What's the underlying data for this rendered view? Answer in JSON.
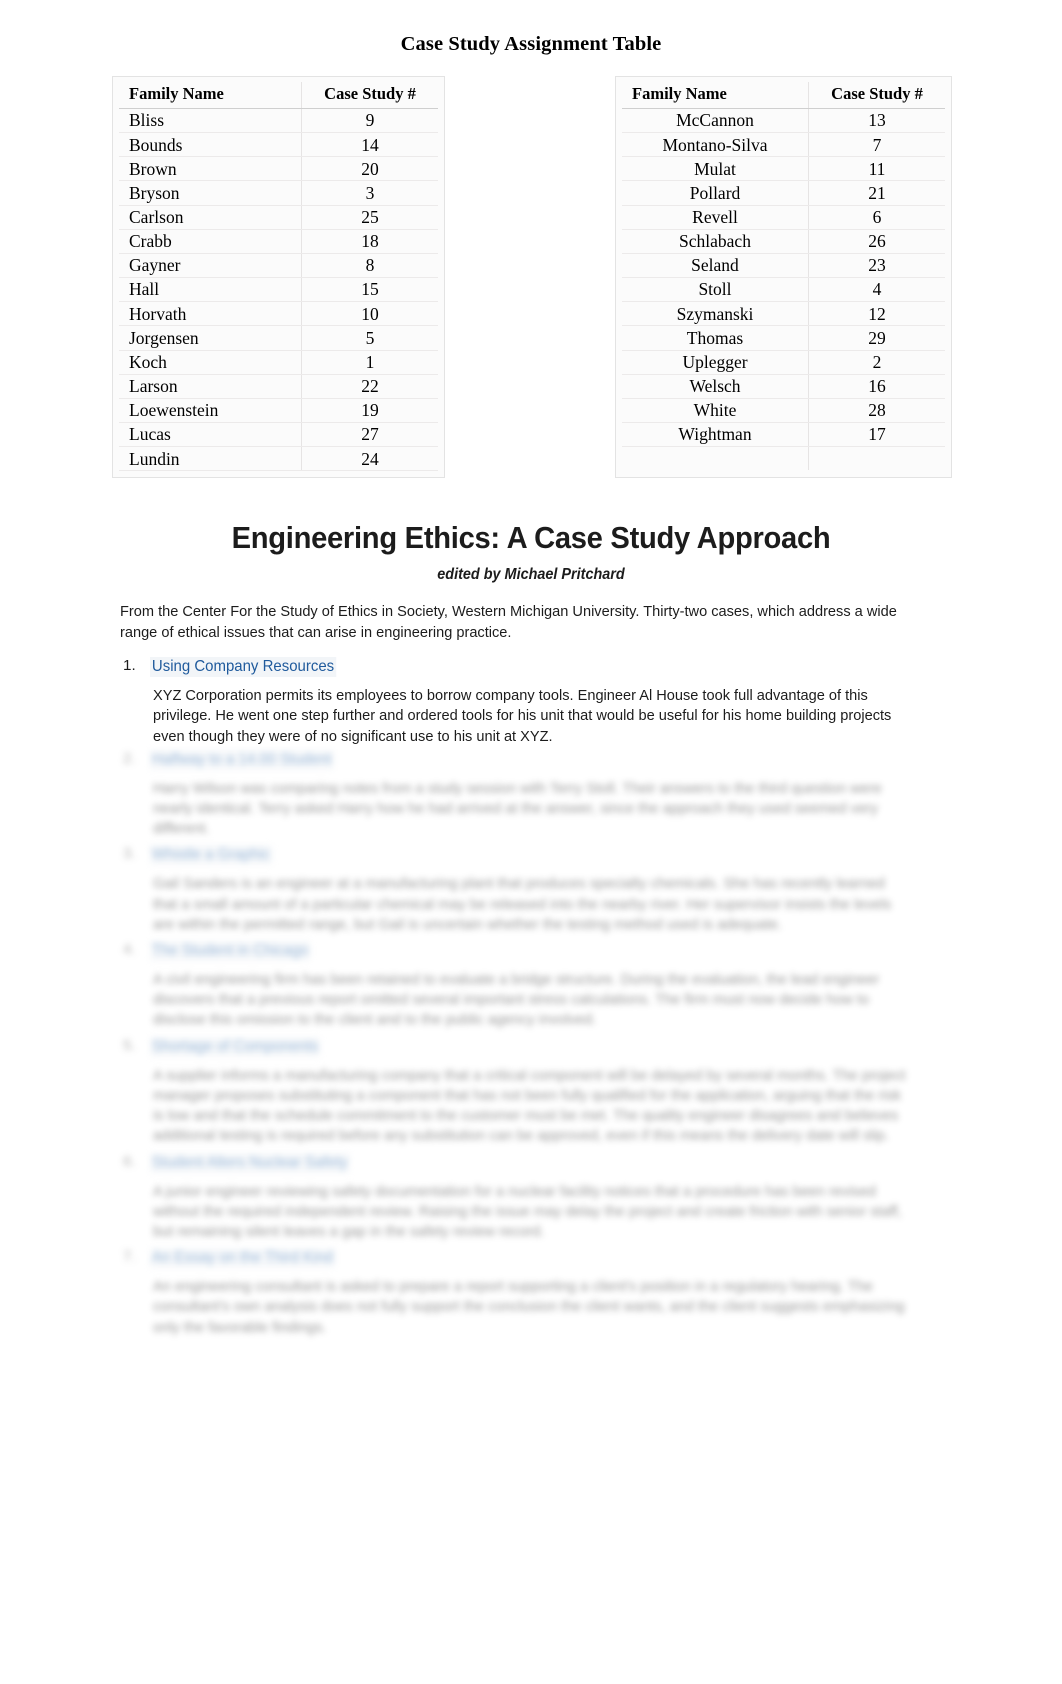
{
  "document": {
    "table_title": "Case Study Assignment Table",
    "tables": {
      "headers": [
        "Family Name",
        "Case Study #"
      ],
      "left": [
        {
          "name": "Bliss",
          "case": "9"
        },
        {
          "name": "Bounds",
          "case": "14"
        },
        {
          "name": "Brown",
          "case": "20"
        },
        {
          "name": "Bryson",
          "case": "3"
        },
        {
          "name": "Carlson",
          "case": "25"
        },
        {
          "name": "Crabb",
          "case": "18"
        },
        {
          "name": "Gayner",
          "case": "8"
        },
        {
          "name": "Hall",
          "case": "15"
        },
        {
          "name": "Horvath",
          "case": "10"
        },
        {
          "name": "Jorgensen",
          "case": "5"
        },
        {
          "name": "Koch",
          "case": "1"
        },
        {
          "name": "Larson",
          "case": "22"
        },
        {
          "name": "Loewenstein",
          "case": "19"
        },
        {
          "name": "Lucas",
          "case": "27"
        },
        {
          "name": "Lundin",
          "case": "24"
        }
      ],
      "right": [
        {
          "name": "McCannon",
          "case": "13"
        },
        {
          "name": "Montano-Silva",
          "case": "7"
        },
        {
          "name": "Mulat",
          "case": "11"
        },
        {
          "name": "Pollard",
          "case": "21"
        },
        {
          "name": "Revell",
          "case": "6"
        },
        {
          "name": "Schlabach",
          "case": "26"
        },
        {
          "name": "Seland",
          "case": "23"
        },
        {
          "name": "Stoll",
          "case": "4"
        },
        {
          "name": "Szymanski",
          "case": "12"
        },
        {
          "name": "Thomas",
          "case": "29"
        },
        {
          "name": "Uplegger",
          "case": "2"
        },
        {
          "name": "Welsch",
          "case": "16"
        },
        {
          "name": "White",
          "case": "28"
        },
        {
          "name": "Wightman",
          "case": "17"
        }
      ]
    },
    "book": {
      "title": "Engineering Ethics: A Case Study Approach",
      "editor": "edited by Michael Pritchard",
      "blurb": "From the Center For the Study of Ethics in Society, Western Michigan University. Thirty-two cases, which address a wide range of ethical issues that can arise in engineering practice."
    },
    "cases": [
      {
        "number": "1.",
        "link": "Using Company Resources",
        "body": "XYZ Corporation permits its employees to borrow company tools. Engineer Al House took full advantage of this privilege. He went one step further and ordered tools for his unit that would be useful for his home building projects even though they were of no significant use to his unit at XYZ.",
        "blurred": false
      },
      {
        "number": "2.",
        "link": "Halfway to a 14.00 Student",
        "body": "Harry Wilson was comparing notes from a study session with Terry Stoll. Their answers to the third question were nearly identical. Terry asked Harry how he had arrived at the answer, since the approach they used seemed very different.",
        "blurred": true
      },
      {
        "number": "3.",
        "link": "Whistle a Graphic",
        "body": "Gail Sanders is an engineer at a manufacturing plant that produces specialty chemicals. She has recently learned that a small amount of a particular chemical may be released into the nearby river. Her supervisor insists the levels are within the permitted range, but Gail is uncertain whether the testing method used is adequate.",
        "blurred": true
      },
      {
        "number": "4.",
        "link": "The Student in Chicago",
        "body": "A civil engineering firm has been retained to evaluate a bridge structure. During the evaluation, the lead engineer discovers that a previous report omitted several important stress calculations. The firm must now decide how to disclose this omission to the client and to the public agency involved.",
        "blurred": true
      },
      {
        "number": "5.",
        "link": "Shortage of Components",
        "body": "A supplier informs a manufacturing company that a critical component will be delayed by several months. The project manager proposes substituting a component that has not been fully qualified for the application, arguing that the risk is low and that the schedule commitment to the customer must be met. The quality engineer disagrees and believes additional testing is required before any substitution can be approved, even if this means the delivery date will slip.",
        "blurred": true
      },
      {
        "number": "6.",
        "link": "Student Alters Nuclear Safety",
        "body": "A junior engineer reviewing safety documentation for a nuclear facility notices that a procedure has been revised without the required independent review. Raising the issue may delay the project and create friction with senior staff, but remaining silent leaves a gap in the safety review record.",
        "blurred": true
      },
      {
        "number": "7.",
        "link": "An Essay on the Third Kind",
        "body": "An engineering consultant is asked to prepare a report supporting a client's position in a regulatory hearing. The consultant's own analysis does not fully support the conclusion the client wants, and the client suggests emphasizing only the favorable findings.",
        "blurred": true
      }
    ]
  }
}
